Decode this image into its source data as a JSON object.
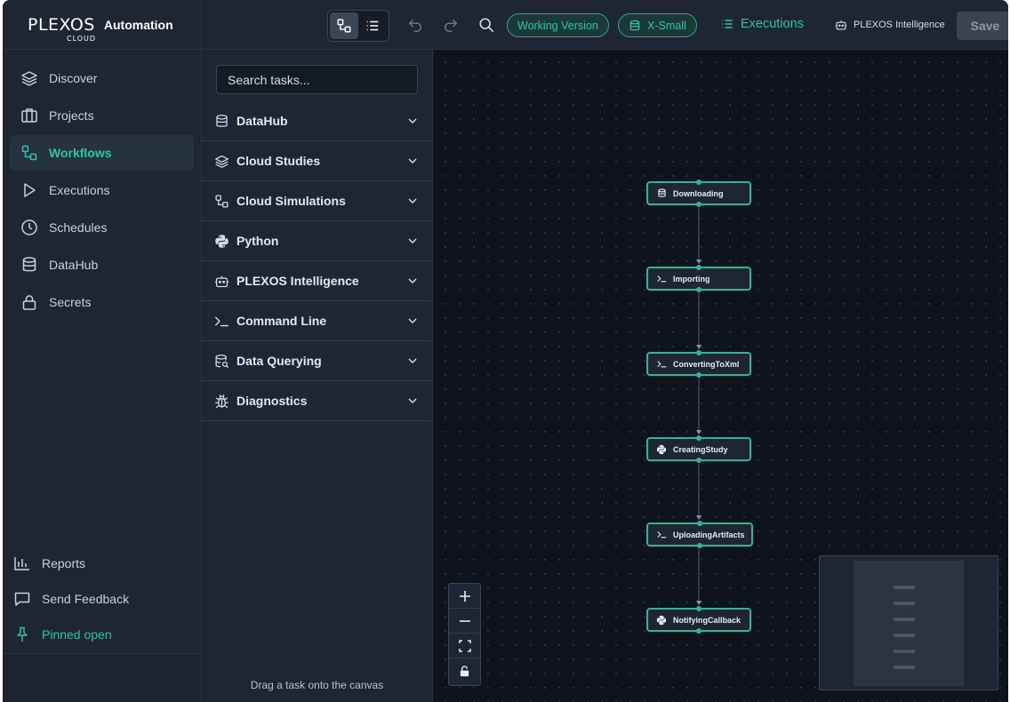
{
  "brand": {
    "logo": "PLEXOS",
    "logo_sub": "CLOUD",
    "product": "Automation"
  },
  "nav": {
    "items": [
      {
        "label": "Discover",
        "icon": "layers-icon"
      },
      {
        "label": "Projects",
        "icon": "folder-icon"
      },
      {
        "label": "Workflows",
        "icon": "workflow-icon",
        "active": true
      },
      {
        "label": "Executions",
        "icon": "play-icon"
      },
      {
        "label": "Schedules",
        "icon": "clock-icon"
      },
      {
        "label": "DataHub",
        "icon": "database-icon"
      },
      {
        "label": "Secrets",
        "icon": "lock-icon"
      }
    ],
    "bottom": [
      {
        "label": "Reports",
        "icon": "bar-chart-icon"
      },
      {
        "label": "Send Feedback",
        "icon": "message-icon"
      },
      {
        "label": "Pinned open",
        "icon": "pin-icon"
      }
    ]
  },
  "toolbar": {
    "version_pill": "Working Version",
    "size_pill": "X-Small",
    "executions_link": "Executions",
    "intelligence_link": "PLEXOS Intelligence",
    "save_label": "Save"
  },
  "tasks": {
    "search_placeholder": "Search tasks...",
    "categories": [
      {
        "label": "DataHub",
        "icon": "database-icon"
      },
      {
        "label": "Cloud Studies",
        "icon": "layers-icon"
      },
      {
        "label": "Cloud Simulations",
        "icon": "workflow-icon"
      },
      {
        "label": "Python",
        "icon": "python-icon"
      },
      {
        "label": "PLEXOS Intelligence",
        "icon": "robot-icon"
      },
      {
        "label": "Command Line",
        "icon": "terminal-icon"
      },
      {
        "label": "Data Querying",
        "icon": "database-search-icon"
      },
      {
        "label": "Diagnostics",
        "icon": "bug-icon"
      }
    ],
    "drag_hint": "Drag a task onto the canvas"
  },
  "workflow": {
    "nodes": [
      {
        "label": "Downloading",
        "icon": "database-icon"
      },
      {
        "label": "Importing",
        "icon": "terminal-icon"
      },
      {
        "label": "ConvertingToXml",
        "icon": "terminal-icon"
      },
      {
        "label": "CreatingStudy",
        "icon": "python-icon"
      },
      {
        "label": "UploadingArtifacts",
        "icon": "terminal-icon"
      },
      {
        "label": "NotifyingCallback",
        "icon": "python-icon"
      }
    ]
  },
  "colors": {
    "accent": "#2ec4a5",
    "background": "#1e2633",
    "canvas": "#0f141c"
  }
}
